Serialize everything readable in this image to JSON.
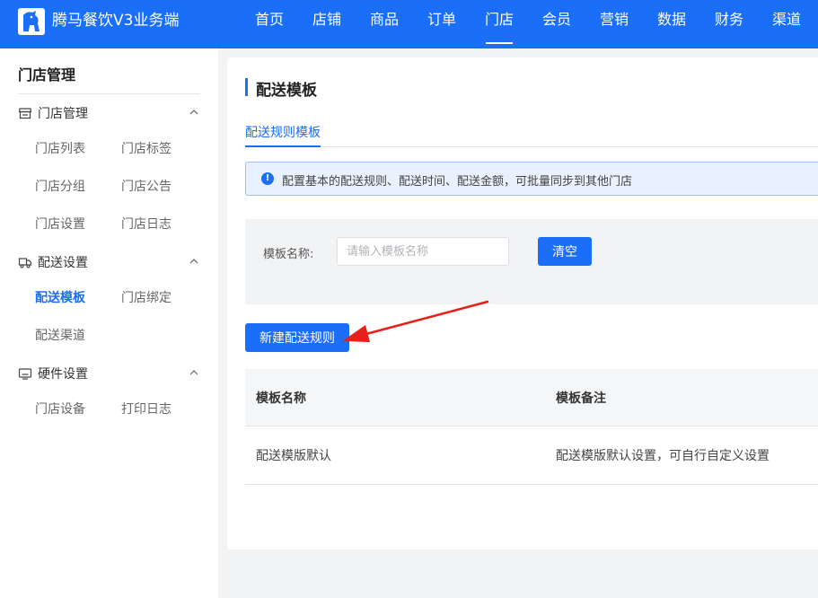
{
  "app": {
    "title": "腾马餐饮V3业务端",
    "accent": "#1a6ef7"
  },
  "topnav": {
    "items": [
      {
        "label": "首页"
      },
      {
        "label": "店铺"
      },
      {
        "label": "商品"
      },
      {
        "label": "订单"
      },
      {
        "label": "门店",
        "active": true
      },
      {
        "label": "会员"
      },
      {
        "label": "营销"
      },
      {
        "label": "数据"
      },
      {
        "label": "财务"
      },
      {
        "label": "渠道"
      }
    ]
  },
  "sidebar": {
    "title": "门店管理",
    "groups": [
      {
        "title": "门店管理",
        "icon": "store-icon",
        "links": [
          "门店列表",
          "门店标签",
          "门店分组",
          "门店公告",
          "门店设置",
          "门店日志"
        ]
      },
      {
        "title": "配送设置",
        "icon": "delivery-icon",
        "links": [
          "配送模板",
          "门店绑定",
          "配送渠道"
        ],
        "active_link": "配送模板"
      },
      {
        "title": "硬件设置",
        "icon": "hardware-icon",
        "links": [
          "门店设备",
          "打印日志"
        ]
      }
    ]
  },
  "main": {
    "page_title": "配送模板",
    "tabs": [
      {
        "label": "配送规则模板",
        "active": true
      }
    ],
    "alert": "配置基本的配送规则、配送时间、配送金额，可批量同步到其他门店",
    "filter": {
      "label": "模板名称:",
      "placeholder": "请输入模板名称",
      "value": "",
      "clear_label": "清空"
    },
    "new_button_label": "新建配送规则",
    "table": {
      "columns": [
        "模板名称",
        "模板备注"
      ],
      "rows": [
        [
          "配送模版默认",
          "配送模版默认设置，可自行自定义设置"
        ]
      ]
    }
  }
}
